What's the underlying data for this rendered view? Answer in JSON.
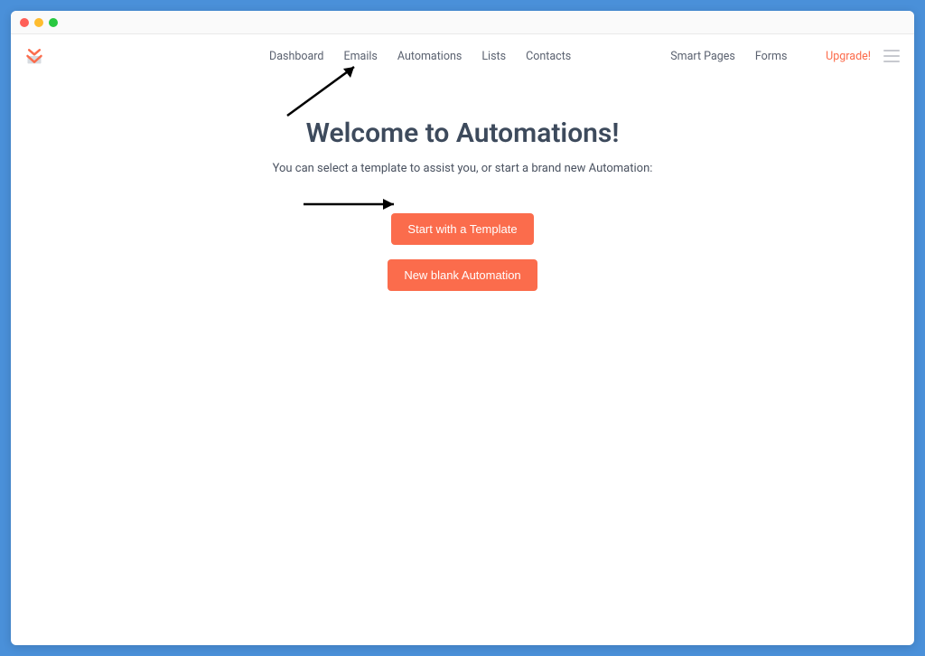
{
  "nav": {
    "primary": [
      "Dashboard",
      "Emails",
      "Automations",
      "Lists",
      "Contacts"
    ],
    "secondary": [
      "Smart Pages",
      "Forms"
    ],
    "upgrade": "Upgrade!"
  },
  "hero": {
    "title": "Welcome to Automations!",
    "subtitle": "You can select a template to assist you, or start a brand new Automation:"
  },
  "buttons": {
    "template": "Start with a Template",
    "blank": "New blank Automation"
  }
}
